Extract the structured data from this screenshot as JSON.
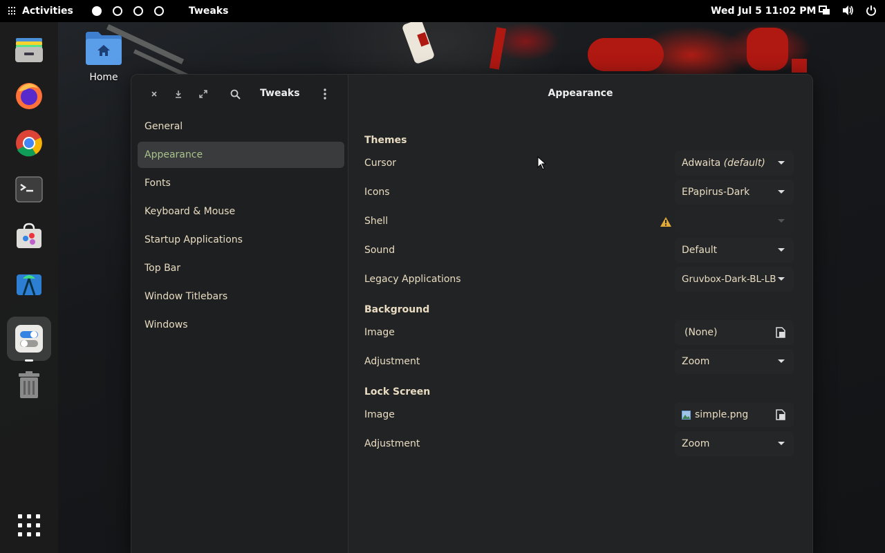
{
  "topbar": {
    "activities": "Activities",
    "app_name": "Tweaks",
    "clock": "Wed Jul 5  11:02 PM",
    "workspaces": [
      true,
      false,
      false,
      false
    ]
  },
  "dock": {
    "items": [
      "file-manager-icon",
      "firefox-icon",
      "chrome-icon",
      "terminal-icon",
      "software-store-icon",
      "android-studio-icon",
      "tweaks-icon",
      "trash-icon"
    ],
    "show_apps_icon": "app-grid-icon"
  },
  "desktop": {
    "home_label": "Home"
  },
  "window": {
    "sidebar_title": "Tweaks",
    "nav": [
      "General",
      "Appearance",
      "Fonts",
      "Keyboard & Mouse",
      "Startup Applications",
      "Top Bar",
      "Window Titlebars",
      "Windows"
    ],
    "active_nav": "Appearance",
    "content_title": "Appearance",
    "themes": {
      "heading": "Themes",
      "cursor_label": "Cursor",
      "cursor_value": "Adwaita",
      "cursor_default": "(default)",
      "icons_label": "Icons",
      "icons_value": "EPapirus-Dark",
      "shell_label": "Shell",
      "shell_value": "",
      "sound_label": "Sound",
      "sound_value": "Default",
      "legacy_label": "Legacy Applications",
      "legacy_value": "Gruvbox-Dark-BL-LB"
    },
    "background": {
      "heading": "Background",
      "image_label": "Image",
      "image_value": "(None)",
      "adjustment_label": "Adjustment",
      "adjustment_value": "Zoom"
    },
    "lockscreen": {
      "heading": "Lock Screen",
      "image_label": "Image",
      "image_value": "simple.png",
      "adjustment_label": "Adjustment",
      "adjustment_value": "Zoom"
    }
  },
  "colors": {
    "accent_active_nav": "#a9c38c",
    "text": "#e9dcc2",
    "warning": "#e0a93a"
  }
}
